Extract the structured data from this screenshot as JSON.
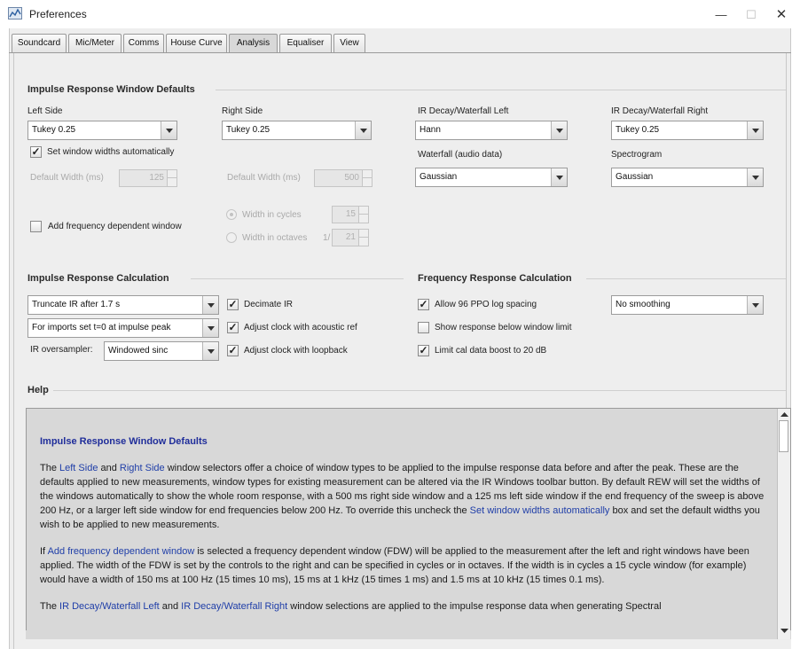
{
  "window": {
    "title": "Preferences",
    "minimize_glyph": "—",
    "maximize_glyph": "☐",
    "close_glyph": "✕"
  },
  "tabs": [
    {
      "label": "Soundcard",
      "active": false
    },
    {
      "label": "Mic/Meter",
      "active": false
    },
    {
      "label": "Comms",
      "active": false
    },
    {
      "label": "House Curve",
      "active": false
    },
    {
      "label": "Analysis",
      "active": true
    },
    {
      "label": "Equaliser",
      "active": false
    },
    {
      "label": "View",
      "active": false
    }
  ],
  "ir_window": {
    "title": "Impulse Response Window Defaults",
    "left_side_label": "Left Side",
    "left_side_value": "Tukey 0.25",
    "right_side_label": "Right Side",
    "right_side_value": "Tukey 0.25",
    "decay_left_label": "IR Decay/Waterfall Left",
    "decay_left_value": "Hann",
    "decay_right_label": "IR Decay/Waterfall Right",
    "decay_right_value": "Tukey 0.25",
    "set_auto_label": "Set window widths automatically",
    "set_auto_checked": true,
    "default_width_left_label": "Default Width (ms)",
    "default_width_left_value": "125",
    "default_width_right_label": "Default Width (ms)",
    "default_width_right_value": "500",
    "waterfall_label": "Waterfall (audio data)",
    "waterfall_value": "Gaussian",
    "spectrogram_label": "Spectrogram",
    "spectrogram_value": "Gaussian",
    "freq_dep_label": "Add frequency dependent window",
    "freq_dep_checked": false,
    "width_cycles_label": "Width in cycles",
    "width_cycles_value": "15",
    "width_octaves_label": "Width in octaves",
    "octaves_prefix": "1/",
    "width_octaves_value": "21"
  },
  "ir_calc": {
    "title": "Impulse Response Calculation",
    "truncate_value": "Truncate IR after 1.7 s",
    "imports_value": "For imports set t=0 at impulse peak",
    "oversampler_label": "IR oversampler:",
    "oversampler_value": "Windowed sinc",
    "decimate_label": "Decimate IR",
    "decimate_checked": true,
    "adjust_acoustic_label": "Adjust clock with acoustic ref",
    "adjust_acoustic_checked": true,
    "adjust_loopback_label": "Adjust clock with loopback",
    "adjust_loopback_checked": true
  },
  "fr_calc": {
    "title": "Frequency Response Calculation",
    "allow96_label": "Allow 96 PPO log spacing",
    "allow96_checked": true,
    "smoothing_value": "No  smoothing",
    "show_below_label": "Show response below window limit",
    "show_below_checked": false,
    "limit_cal_label": "Limit cal data boost to 20 dB",
    "limit_cal_checked": true
  },
  "help": {
    "title": "Help",
    "heading": "Impulse Response Window Defaults",
    "p1_a": "The ",
    "p1_hl1": "Left Side",
    "p1_b": " and ",
    "p1_hl2": "Right Side",
    "p1_c": " window selectors offer a choice of window types to be applied to the impulse response data before and after the peak. These are the defaults applied to new measurements, window types for existing measurement can be altered via the IR Windows toolbar button. By default REW will set the widths of the windows automatically to show the whole room response, with a 500 ms right side window and a 125 ms left side window if the end frequency of the sweep is above 200 Hz, or a larger left side window for end frequencies below 200 Hz. To override this uncheck the ",
    "p1_hl3": "Set window widths automatically",
    "p1_d": " box and set the default widths you wish to be applied to new measurements.",
    "p2_a": "If ",
    "p2_hl1": "Add frequency dependent window",
    "p2_b": " is selected a frequency dependent window (FDW) will be applied to the measurement after the left and right windows have been applied. The width of the FDW is set by the controls to the right and can be specified in cycles or in octaves. If the width is in cycles a 15 cycle window (for example) would have a width of 150 ms at 100 Hz (15 times 10 ms), 15 ms at 1 kHz (15 times 1 ms) and 1.5 ms at 10 kHz (15 times 0.1 ms).",
    "p3_a": "The ",
    "p3_hl1": "IR Decay/Waterfall Left",
    "p3_b": " and ",
    "p3_hl2": "IR Decay/Waterfall Right",
    "p3_c": " window selections are applied to the impulse response data when generating Spectral"
  }
}
